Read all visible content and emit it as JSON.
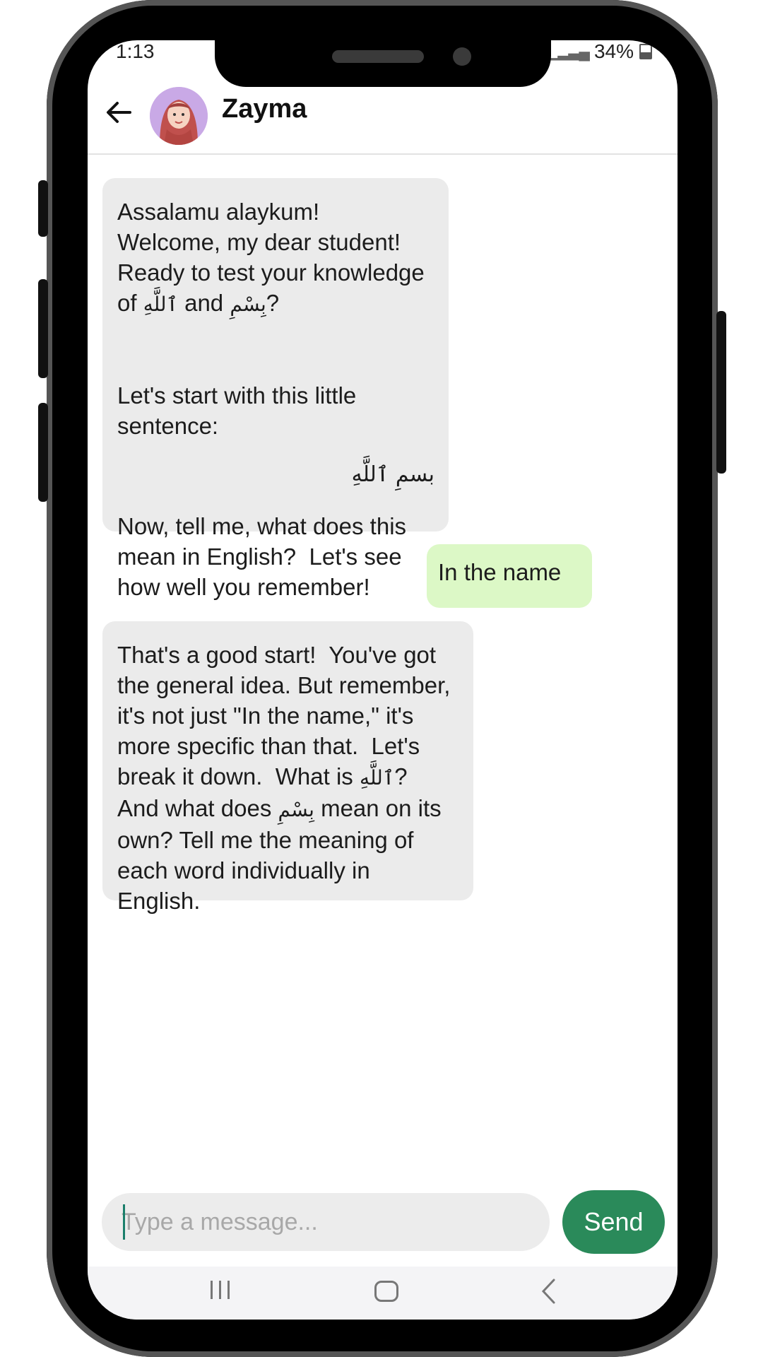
{
  "status_bar": {
    "time": "1:13",
    "battery": "34%"
  },
  "header": {
    "contact_name": "Zayma"
  },
  "messages": [
    {
      "sender": "bot",
      "p1_a": "Assalamu alaykum!  Welcome, my dear student!  Ready to test your knowledge of ",
      "p1_arabic1": "ٱللَّهِ",
      "p1_b": " and ",
      "p1_arabic2": "بِسْمِ",
      "p1_c": "?",
      "p2": "Let's start with this little sentence:",
      "p3_arabic": "بسمِ ٱللَّهِ",
      "p4": "Now, tell me, what does this mean in English?  Let's see how well you remember!"
    },
    {
      "sender": "user",
      "text": "In the name"
    },
    {
      "sender": "bot",
      "p1_a": "That's a good start!  You've got the general idea. But remember, it's not just \"In the name,\" it's more specific than that.  Let's break it down.  What is ",
      "p1_arabic1": "ٱللَّهِ",
      "p1_b": "?  And what does ",
      "p1_arabic2": "بِسْمِ",
      "p1_c": " mean on its own? Tell me the meaning of each word individually in English."
    }
  ],
  "composer": {
    "placeholder": "Type a message...",
    "value": "",
    "send_label": "Send"
  },
  "colors": {
    "user_bubble": "#dcf8c6",
    "bot_bubble": "#ebebeb",
    "send_button": "#2a8a5a"
  }
}
